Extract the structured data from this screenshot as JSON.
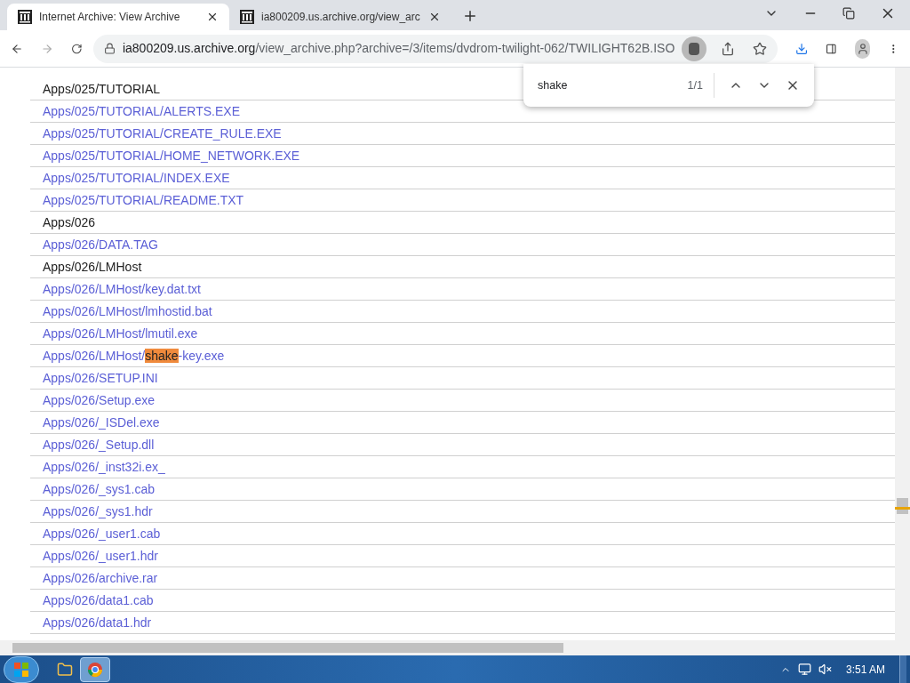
{
  "tabs": [
    {
      "title": "Internet Archive: View Archive",
      "selected": true
    },
    {
      "title": "ia800209.us.archive.org/view_arc",
      "selected": false
    }
  ],
  "address_bar": {
    "url_host": "ia800209.us.archive.org",
    "url_path": "/view_archive.php?archive=/3/items/dvdrom-twilight-062/TWILIGHT62B.ISO"
  },
  "find_bar": {
    "query": "shake",
    "count": "1/1"
  },
  "rows": [
    {
      "kind": "folder",
      "segments": [
        {
          "text": "Apps/025/TUTORIAL",
          "highlighted": false
        }
      ]
    },
    {
      "kind": "link",
      "segments": [
        {
          "text": "Apps/025/TUTORIAL/ALERTS.EXE",
          "highlighted": false
        }
      ]
    },
    {
      "kind": "link",
      "segments": [
        {
          "text": "Apps/025/TUTORIAL/CREATE_RULE.EXE",
          "highlighted": false
        }
      ]
    },
    {
      "kind": "link",
      "segments": [
        {
          "text": "Apps/025/TUTORIAL/HOME_NETWORK.EXE",
          "highlighted": false
        }
      ]
    },
    {
      "kind": "link",
      "segments": [
        {
          "text": "Apps/025/TUTORIAL/INDEX.EXE",
          "highlighted": false
        }
      ]
    },
    {
      "kind": "link",
      "segments": [
        {
          "text": "Apps/025/TUTORIAL/README.TXT",
          "highlighted": false
        }
      ]
    },
    {
      "kind": "folder",
      "segments": [
        {
          "text": "Apps/026",
          "highlighted": false
        }
      ]
    },
    {
      "kind": "link",
      "segments": [
        {
          "text": "Apps/026/DATA.TAG",
          "highlighted": false
        }
      ]
    },
    {
      "kind": "folder",
      "segments": [
        {
          "text": "Apps/026/LMHost",
          "highlighted": false
        }
      ]
    },
    {
      "kind": "link",
      "segments": [
        {
          "text": "Apps/026/LMHost/key.dat.txt",
          "highlighted": false
        }
      ]
    },
    {
      "kind": "link",
      "segments": [
        {
          "text": "Apps/026/LMHost/lmhostid.bat",
          "highlighted": false
        }
      ]
    },
    {
      "kind": "link",
      "segments": [
        {
          "text": "Apps/026/LMHost/lmutil.exe",
          "highlighted": false
        }
      ]
    },
    {
      "kind": "link",
      "segments": [
        {
          "text": "Apps/026/LMHost/",
          "highlighted": false
        },
        {
          "text": "shake",
          "highlighted": true
        },
        {
          "text": "-key.exe",
          "highlighted": false
        }
      ]
    },
    {
      "kind": "link",
      "segments": [
        {
          "text": "Apps/026/SETUP.INI",
          "highlighted": false
        }
      ]
    },
    {
      "kind": "link",
      "segments": [
        {
          "text": "Apps/026/Setup.exe",
          "highlighted": false
        }
      ]
    },
    {
      "kind": "link",
      "segments": [
        {
          "text": "Apps/026/_ISDel.exe",
          "highlighted": false
        }
      ]
    },
    {
      "kind": "link",
      "segments": [
        {
          "text": "Apps/026/_Setup.dll",
          "highlighted": false
        }
      ]
    },
    {
      "kind": "link",
      "segments": [
        {
          "text": "Apps/026/_inst32i.ex_",
          "highlighted": false
        }
      ]
    },
    {
      "kind": "link",
      "segments": [
        {
          "text": "Apps/026/_sys1.cab",
          "highlighted": false
        }
      ]
    },
    {
      "kind": "link",
      "segments": [
        {
          "text": "Apps/026/_sys1.hdr",
          "highlighted": false
        }
      ]
    },
    {
      "kind": "link",
      "segments": [
        {
          "text": "Apps/026/_user1.cab",
          "highlighted": false
        }
      ]
    },
    {
      "kind": "link",
      "segments": [
        {
          "text": "Apps/026/_user1.hdr",
          "highlighted": false
        }
      ]
    },
    {
      "kind": "link",
      "segments": [
        {
          "text": "Apps/026/archive.rar",
          "highlighted": false
        }
      ]
    },
    {
      "kind": "link",
      "segments": [
        {
          "text": "Apps/026/data1.cab",
          "highlighted": false
        }
      ]
    },
    {
      "kind": "link",
      "segments": [
        {
          "text": "Apps/026/data1.hdr",
          "highlighted": false
        }
      ]
    }
  ],
  "taskbar": {
    "clock": "3:51 AM"
  }
}
